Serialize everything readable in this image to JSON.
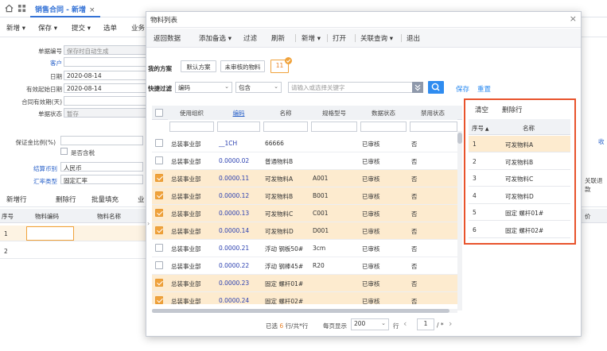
{
  "app": {
    "tab_title": "销售合同 - 新增",
    "toolbar": [
      "新增",
      "保存",
      "提交",
      "选单",
      "业务"
    ],
    "form": {
      "bill_no_label": "单据编号",
      "bill_no_placeholder": "保存时自动生成",
      "customer_label": "客户",
      "date_label": "日期",
      "date_value": "2020-08-14",
      "valid_start_label": "有效起始日期",
      "valid_start_value": "2020-08-14",
      "valid_period_label": "合同有效期(天)",
      "status_label": "单据状态",
      "status_value": "暂存",
      "deposit_label": "保证金比例(%)",
      "tax_included_label": "是否含税",
      "currency_label": "结算币别",
      "currency_value": "人民币",
      "rate_type_label": "汇率类型",
      "rate_type_value": "固定汇率"
    },
    "right_edge_labels": [
      "收",
      "关联退款"
    ],
    "subbar": [
      "新增行",
      "删除行",
      "批量填充",
      "业"
    ],
    "grid_headers": [
      "序号",
      "物料编码",
      "物料名称",
      "价"
    ],
    "grid_rows": [
      "1",
      "2"
    ]
  },
  "modal": {
    "title": "物料列表",
    "close": "×",
    "toolbar": [
      "返回数据",
      "添加备选",
      "过滤",
      "刷新",
      "新增",
      "打开",
      "关联查询",
      "退出"
    ],
    "scheme_label": "我的方案",
    "scheme_default": "默认方案",
    "scheme_unapproved": "未审核的物料",
    "scheme_count": "11",
    "quick_filter_label": "快捷过滤",
    "filter_field": "编码",
    "filter_op": "包含",
    "filter_placeholder": "请输入或选择关键字",
    "save": "保存",
    "reset": "重置",
    "columns": [
      "使用组织",
      "编码",
      "名称",
      "规格型号",
      "数据状态",
      "禁用状态"
    ],
    "rows": [
      {
        "checked": false,
        "org": "总装事业部",
        "code": "__1CH",
        "name": "66666",
        "spec": "",
        "status": "已审核",
        "disabled": "否"
      },
      {
        "checked": false,
        "org": "总装事业部",
        "code": "0.0000.02",
        "name": "普通物料B",
        "spec": "",
        "status": "已审核",
        "disabled": "否"
      },
      {
        "checked": true,
        "org": "总装事业部",
        "code": "0.0000.11",
        "name": "可发物料A",
        "spec": "A001",
        "status": "已审核",
        "disabled": "否"
      },
      {
        "checked": true,
        "org": "总装事业部",
        "code": "0.0000.12",
        "name": "可发物料B",
        "spec": "B001",
        "status": "已审核",
        "disabled": "否"
      },
      {
        "checked": true,
        "org": "总装事业部",
        "code": "0.0000.13",
        "name": "可发物料C",
        "spec": "C001",
        "status": "已审核",
        "disabled": "否"
      },
      {
        "checked": true,
        "org": "总装事业部",
        "code": "0.0000.14",
        "name": "可发物料D",
        "spec": "D001",
        "status": "已审核",
        "disabled": "否"
      },
      {
        "checked": false,
        "org": "总装事业部",
        "code": "0.0000.21",
        "name": "浮动 钢板50#",
        "spec": "3cm",
        "status": "已审核",
        "disabled": "否"
      },
      {
        "checked": false,
        "org": "总装事业部",
        "code": "0.0000.22",
        "name": "浮动 钢棒45#",
        "spec": "R20",
        "status": "已审核",
        "disabled": "否"
      },
      {
        "checked": true,
        "org": "总装事业部",
        "code": "0.0000.23",
        "name": "固定 螺杆01#",
        "spec": "",
        "status": "已审核",
        "disabled": "否"
      },
      {
        "checked": true,
        "org": "总装事业部",
        "code": "0.0000.24",
        "name": "固定 螺杆02#",
        "spec": "",
        "status": "已审核",
        "disabled": "否"
      }
    ],
    "pager": {
      "selected_prefix": "已选",
      "selected_count": "6",
      "selected_suffix": "行/共*行",
      "per_page_label": "每页显示",
      "per_page_value": "200",
      "row_unit": "行",
      "page_value": "1",
      "page_total": "/ *"
    },
    "right_panel": {
      "clear": "清空",
      "delete_row": "删除行",
      "col_no": "序号",
      "col_name": "名称",
      "items": [
        {
          "no": "1",
          "name": "可发物料A"
        },
        {
          "no": "2",
          "name": "可发物料B"
        },
        {
          "no": "3",
          "name": "可发物料C"
        },
        {
          "no": "4",
          "name": "可发物料D"
        },
        {
          "no": "5",
          "name": "固定 螺杆01#"
        },
        {
          "no": "6",
          "name": "固定 螺杆02#"
        }
      ]
    }
  },
  "colors": {
    "accent": "#2a62c9",
    "selected_row": "#fdebcf",
    "checkbox_on": "#f0a23b",
    "highlight_border": "#e8532c"
  }
}
